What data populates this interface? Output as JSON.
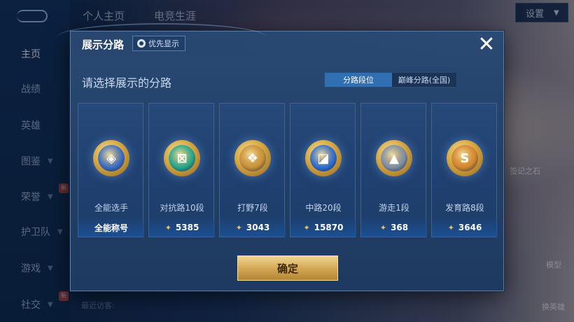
{
  "background": {
    "top_tabs": [
      "个人主页",
      "电竞生涯"
    ],
    "sidebar": {
      "items": [
        {
          "label": "主页",
          "active": true,
          "chevron": false
        },
        {
          "label": "战绩",
          "active": false,
          "chevron": false
        },
        {
          "label": "英雄",
          "active": false,
          "chevron": false
        },
        {
          "label": "图鉴",
          "active": false,
          "chevron": true
        },
        {
          "label": "荣誉",
          "active": false,
          "chevron": true,
          "new": "新"
        },
        {
          "label": "护卫队",
          "active": false,
          "chevron": true
        },
        {
          "label": "游戏",
          "active": false,
          "chevron": true
        },
        {
          "label": "社交",
          "active": false,
          "chevron": true,
          "new": "新"
        }
      ]
    },
    "settings_label": "设置",
    "visitor_label": "最近访客:",
    "right_labels": [
      "签记之石",
      "换英雄",
      "模型"
    ]
  },
  "modal": {
    "title": "展示分路",
    "priority_label": "优先显示",
    "close_icon": "close-icon",
    "subtitle": "请选择展示的分路",
    "tabs": [
      {
        "label": "分路段位",
        "active": true
      },
      {
        "label": "巅峰分路(全国)",
        "active": false
      }
    ],
    "cards": [
      {
        "name": "全能选手",
        "footer": "全能称号",
        "show_icon": false,
        "badge_glyph": "◈",
        "badge_color": "#3d6fc2"
      },
      {
        "name": "对抗路10段",
        "footer": "5385",
        "show_icon": true,
        "badge_glyph": "⊠",
        "badge_color": "#27a88e"
      },
      {
        "name": "打野7段",
        "footer": "3043",
        "show_icon": true,
        "badge_glyph": "❖",
        "badge_color": "#c9923a"
      },
      {
        "name": "中路20段",
        "footer": "15870",
        "show_icon": true,
        "badge_glyph": "◪",
        "badge_color": "#2f6fd0"
      },
      {
        "name": "游走1段",
        "footer": "368",
        "show_icon": true,
        "badge_glyph": "▲",
        "badge_color": "#7d8ea6"
      },
      {
        "name": "发育路8段",
        "footer": "3646",
        "show_icon": true,
        "badge_glyph": "S",
        "badge_color": "#d4872f"
      }
    ],
    "confirm_label": "确定"
  }
}
